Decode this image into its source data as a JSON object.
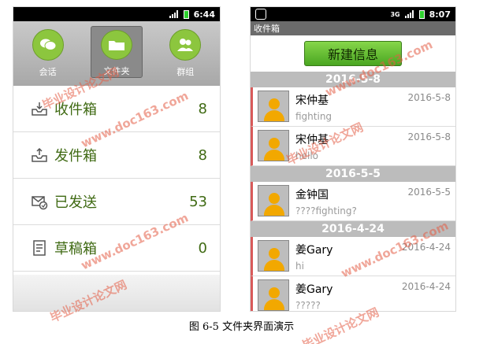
{
  "left_phone": {
    "statusbar": {
      "time": "6:44"
    },
    "tabs": [
      {
        "label": "会话",
        "icon": "chat-bubbles-icon",
        "selected": false
      },
      {
        "label": "文件夹",
        "icon": "folder-icon",
        "selected": true
      },
      {
        "label": "群组",
        "icon": "group-icon",
        "selected": false
      }
    ],
    "folders": [
      {
        "name": "收件箱",
        "count": "8",
        "icon": "inbox-icon"
      },
      {
        "name": "发件箱",
        "count": "8",
        "icon": "outbox-icon"
      },
      {
        "name": "已发送",
        "count": "53",
        "icon": "sent-icon"
      },
      {
        "name": "草稿箱",
        "count": "0",
        "icon": "draft-icon"
      }
    ]
  },
  "right_phone": {
    "statusbar": {
      "time": "8:07",
      "network": "3G"
    },
    "title": "收件箱",
    "new_button_label": "新建信息",
    "groups": [
      {
        "date": "2016-5-8",
        "messages": [
          {
            "name": "宋仲基",
            "date": "2016-5-8",
            "preview": "fighting"
          },
          {
            "name": "宋仲基",
            "date": "2016-5-8",
            "preview": "hello"
          }
        ]
      },
      {
        "date": "2016-5-5",
        "messages": [
          {
            "name": "金钟国",
            "date": "2016-5-5",
            "preview": "????fighting?"
          }
        ]
      },
      {
        "date": "2016-4-24",
        "messages": [
          {
            "name": "姜Gary",
            "date": "2016-4-24",
            "preview": "hi"
          },
          {
            "name": "姜Gary",
            "date": "2016-4-24",
            "preview": "?????"
          }
        ]
      }
    ]
  },
  "caption": "图 6-5  文件夹界面演示",
  "watermark": {
    "cn": "毕业设计论文网",
    "url": "www.doc163.com"
  },
  "colors": {
    "accent_green": "#8cc63e",
    "folder_text": "#3f6a13",
    "date_header": "#bcbcbc"
  }
}
